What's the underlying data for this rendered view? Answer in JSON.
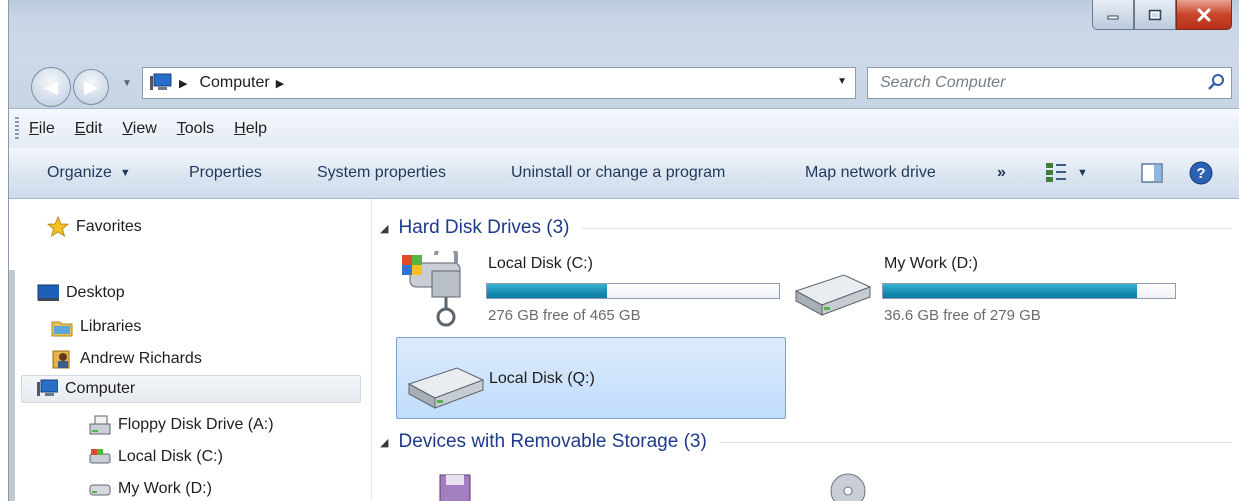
{
  "window": {
    "caption_buttons": {
      "minimize_icon": "minimize-icon",
      "maximize_icon": "maximize-icon",
      "close_icon": "close-icon"
    }
  },
  "address_bar": {
    "location": "Computer",
    "search_placeholder": "Search Computer"
  },
  "menu": {
    "items": [
      {
        "label": "File",
        "key": "F"
      },
      {
        "label": "Edit",
        "key": "E"
      },
      {
        "label": "View",
        "key": "V"
      },
      {
        "label": "Tools",
        "key": "T"
      },
      {
        "label": "Help",
        "key": "H"
      }
    ]
  },
  "toolbar": {
    "organize": "Organize",
    "properties": "Properties",
    "system_properties": "System properties",
    "uninstall": "Uninstall or change a program",
    "map_drive": "Map network drive",
    "more": "»"
  },
  "nav_pane": {
    "favorites": "Favorites",
    "desktop": "Desktop",
    "libraries": "Libraries",
    "user": "Andrew Richards",
    "computer": "Computer",
    "floppy": "Floppy Disk Drive (A:)",
    "local_c": "Local Disk (C:)",
    "my_work": "My Work (D:)"
  },
  "content": {
    "hard_disk_group": "Hard Disk Drives (3)",
    "removable_group": "Devices with Removable Storage (3)",
    "drives": [
      {
        "name": "Local Disk (C:)",
        "free_text": "276 GB free of 465 GB",
        "used_fraction": 0.41
      },
      {
        "name": "My Work (D:)",
        "free_text": "36.6 GB free of 279 GB",
        "used_fraction": 0.87
      },
      {
        "name": "Local Disk (Q:)"
      }
    ]
  },
  "colors": {
    "accent": "#1e3a8a",
    "bar_fill": "#1a8eb4",
    "selection": "#c1dcfc"
  }
}
